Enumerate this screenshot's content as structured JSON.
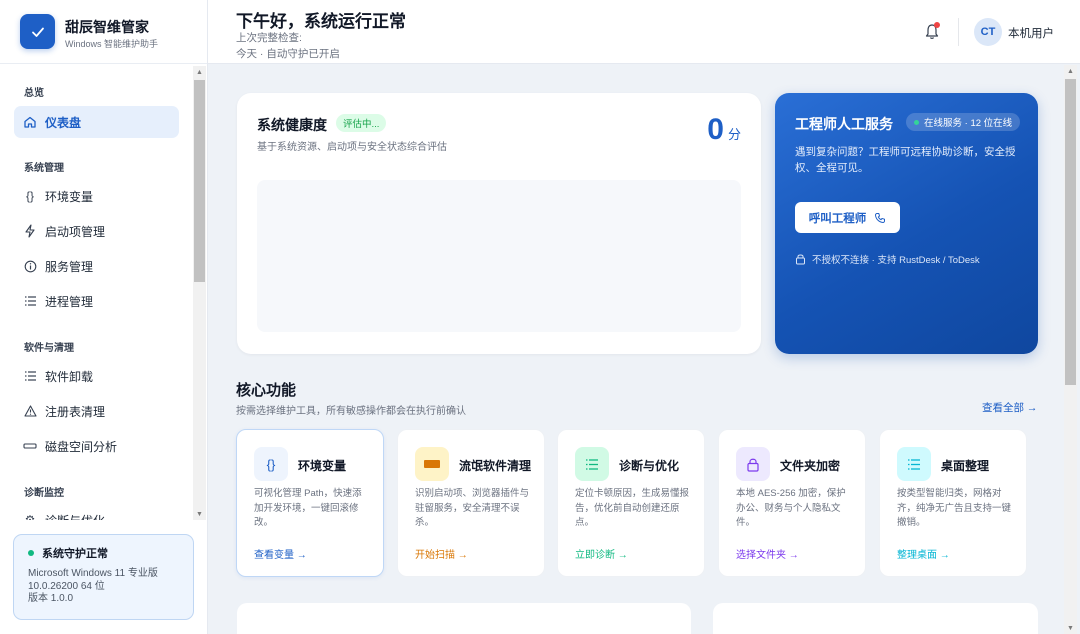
{
  "brand": {
    "name": "甜辰智维管家",
    "subtitle": "Windows 智能维护助手"
  },
  "sidebar": {
    "sections": [
      {
        "label": "总览"
      },
      {
        "label": "系统管理"
      },
      {
        "label": "软件与清理"
      },
      {
        "label": "诊断监控"
      }
    ],
    "items": [
      {
        "label": "仪表盘",
        "icon": "home-icon"
      },
      {
        "label": "环境变量",
        "icon": "braces-icon"
      },
      {
        "label": "启动项管理",
        "icon": "lightning-icon"
      },
      {
        "label": "服务管理",
        "icon": "info-circle-icon"
      },
      {
        "label": "进程管理",
        "icon": "list-icon"
      },
      {
        "label": "软件卸载",
        "icon": "list-icon"
      },
      {
        "label": "注册表清理",
        "icon": "warning-icon"
      },
      {
        "label": "磁盘空间分析",
        "icon": "disk-icon"
      },
      {
        "label": "诊断与优化",
        "icon": "wrench-icon"
      }
    ],
    "status": {
      "title": "系统守护正常",
      "os": "Microsoft Windows 11 专业版",
      "build": "10.0.26200 64 位",
      "version": "版本 1.0.0"
    }
  },
  "header": {
    "greeting": "下午好，系统运行正常",
    "last_check": "上次完整检查:",
    "last_check_detail": "今天 · 自动守护已开启",
    "avatar_initials": "CT",
    "user": "本机用户"
  },
  "health": {
    "title": "系统健康度",
    "badge": "评估中...",
    "desc": "基于系统资源、启动项与安全状态综合评估",
    "score": "0",
    "unit": "分"
  },
  "engineer": {
    "title": "工程师人工服务",
    "online": "在线服务 · 12 位在线",
    "desc": "遇到复杂问题？工程师可远程协助诊断，安全授权、全程可见。",
    "button": "呼叫工程师",
    "footer": "不授权不连接 · 支持 RustDesk / ToDesk"
  },
  "core": {
    "title": "核心功能",
    "desc": "按需选择维护工具，所有敏感操作都会在执行前确认",
    "see_all": "查看全部 →"
  },
  "features": [
    {
      "title": "环境变量",
      "desc": "可视化管理 Path，快速添加开发环境，一键回滚修改。",
      "link": "查看变量 →",
      "color": "#1e5fc6",
      "icon": "braces-icon"
    },
    {
      "title": "流氓软件清理",
      "desc": "识别启动项、浏览器插件与驻留服务，安全清理不误杀。",
      "link": "开始扫描 →",
      "color": "#d97706",
      "icon": "broom-icon"
    },
    {
      "title": "诊断与优化",
      "desc": "定位卡顿原因，生成易懂报告，优化前自动创建还原点。",
      "link": "立即诊断 →",
      "color": "#10b981",
      "icon": "checklist-icon"
    },
    {
      "title": "文件夹加密",
      "desc": "本地 AES-256 加密，保护办公、财务与个人隐私文件。",
      "link": "选择文件夹 →",
      "color": "#7c3aed",
      "icon": "lock-icon"
    },
    {
      "title": "桌面整理",
      "desc": "按类型智能归类，网格对齐，纯净无广告且支持一键撤销。",
      "link": "整理桌面 →",
      "color": "#06b6d4",
      "icon": "grid-list-icon"
    }
  ]
}
